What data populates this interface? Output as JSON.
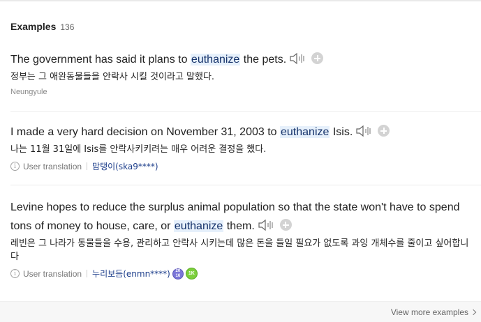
{
  "header": {
    "title": "Examples",
    "count": "136"
  },
  "examples": [
    {
      "en_before": "The government has said it plans to ",
      "keyword": "euthanize",
      "en_after": " the pets.",
      "ko": "정부는 그 애완동물들을 안락사 시킬 것이라고 말했다.",
      "author": "Neungyule"
    },
    {
      "en_before": "I made a very hard decision on November 31, 2003 to ",
      "keyword": "euthanize",
      "en_after": " Isis.",
      "ko": "나는 11월 31일에 Isis를 안락사키키려는 매우 어려운 결정을 했다.",
      "user_translation_label": "User translation",
      "translator": "맘탱이(ska9****)"
    },
    {
      "en_before": "Levine hopes to reduce the surplus animal population so that the state won't have to spend tons of money to house, care, or ",
      "keyword": "euthanize",
      "en_after": " them.",
      "ko": "레빈은 그 나라가 동물들을 수용, 관리하고 안락사 시키는데 많은 돈을 들일 필요가 없도록 과잉 개체수를 줄이고 싶어합니다",
      "user_translation_label": "User translation",
      "translator": "누리보듬(enmn****)",
      "badge_level": "20\n16",
      "badge_count": "1K"
    }
  ],
  "footer": {
    "view_more": "View more examples"
  },
  "icons": [
    "speaker-icon",
    "add-icon",
    "info-icon",
    "chevron-right-icon"
  ],
  "colors": {
    "highlight_bg": "#e6f0fb",
    "translator_link": "#1b3c8a",
    "badge_green": "#7ccf3c",
    "badge_purple": "#7b76d8"
  }
}
